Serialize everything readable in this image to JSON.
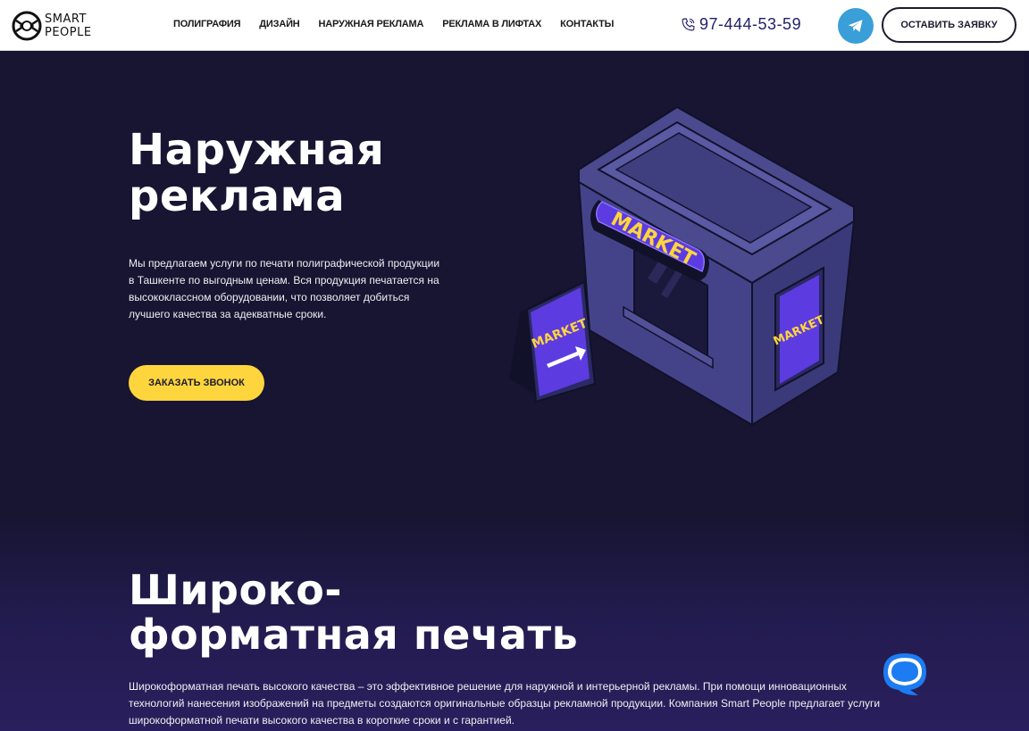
{
  "header": {
    "logo_line1": "SMART",
    "logo_line2": "PEOPLE",
    "nav": [
      {
        "label": "ПОЛИГРАФИЯ"
      },
      {
        "label": "ДИЗАЙН"
      },
      {
        "label": "НАРУЖНАЯ РЕКЛАМА"
      },
      {
        "label": "РЕКЛАМА В ЛИФТАХ"
      },
      {
        "label": "КОНТАКТЫ"
      }
    ],
    "phone": "97-444-53-59",
    "telegram_icon": "telegram-icon",
    "request_button": "ОСТАВИТЬ ЗАЯВКУ"
  },
  "hero": {
    "title_line1": "Наружная",
    "title_line2": "реклама",
    "description": "Мы предлагаем услуги по печати полиграфической продукции в Ташкенте по выгодным ценам. Вся продукция печатается на высококлассном оборудовании, что позволяет добиться лучшего качества за адекватные сроки.",
    "call_button": "ЗАКАЗАТЬ ЗВОНОК",
    "illustration": {
      "sign_main": "MARKET",
      "sign_board": "MARKET",
      "sign_side": "MARKET"
    }
  },
  "section": {
    "title_line1": "Широко-",
    "title_line2": "форматная печать",
    "description": "Широкоформатная печать высокого качества – это эффективное решение для наружной и интерьерной рекламы. При помощи инновационных технологий нанесения изображений на предметы создаются оригинальные образцы рекламной продукции. Компания Smart People предлагает услуги широкоформатной печати высокого качества в короткие сроки и с гарантией."
  },
  "colors": {
    "background": "#171532",
    "accent_yellow": "#fed53d",
    "accent_purple": "#5c3be0",
    "telegram_blue": "#3a9fd8"
  },
  "chat_widget_icon": "chat-bubble-icon"
}
